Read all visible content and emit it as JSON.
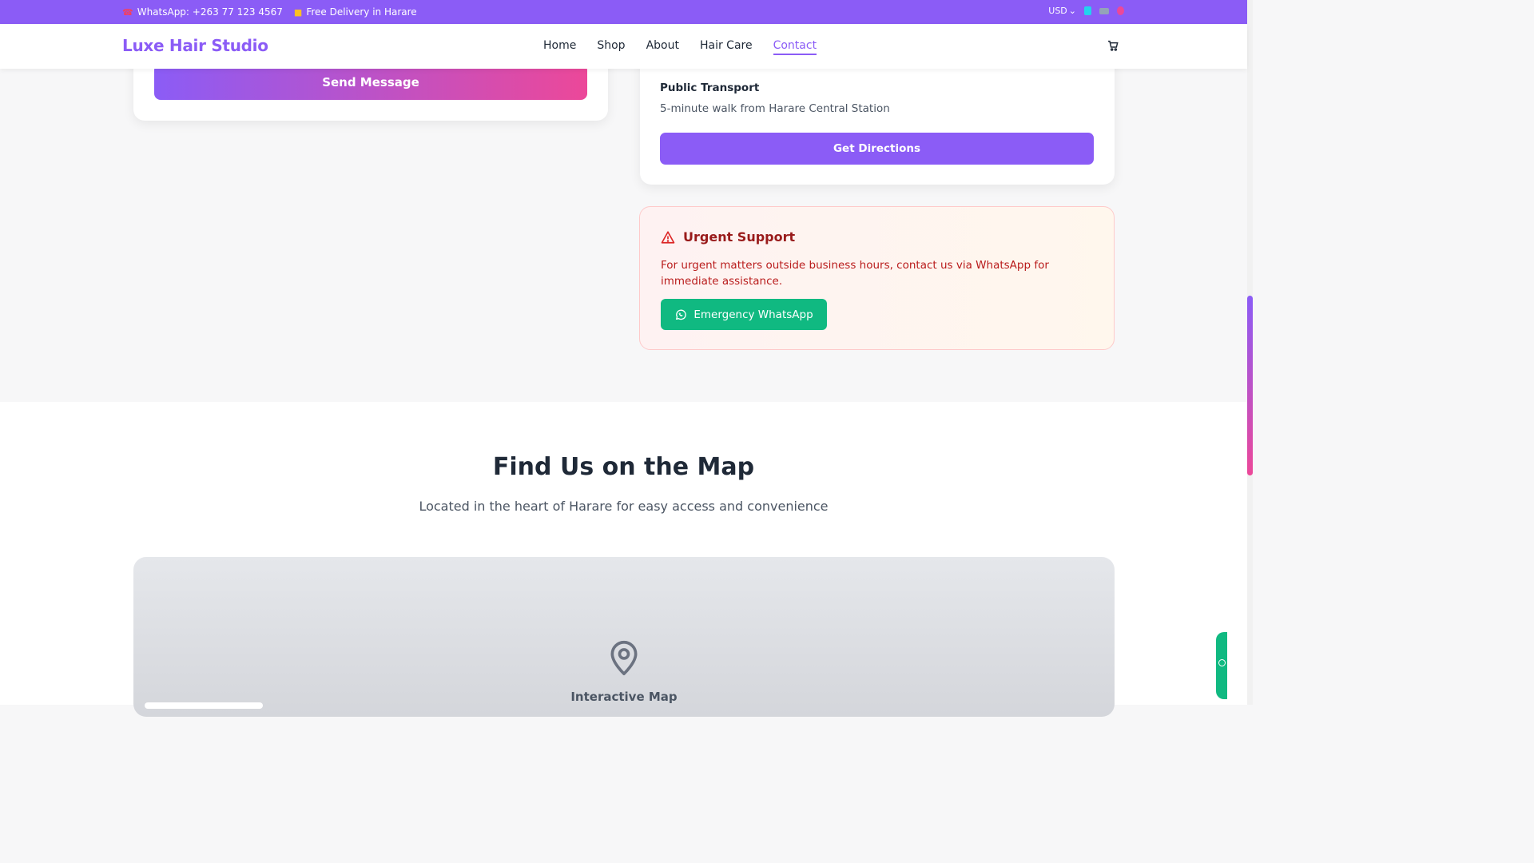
{
  "topbar": {
    "whatsapp": "WhatsApp: +263 77 123 4567",
    "delivery": "Free Delivery in Harare",
    "currency": "USD"
  },
  "header": {
    "logo": "Luxe Hair Studio",
    "nav": [
      "Home",
      "Shop",
      "About",
      "Hair Care",
      "Contact"
    ],
    "active_nav": "Contact"
  },
  "form": {
    "send_label": "Send Message"
  },
  "location": {
    "transport_title": "Public Transport",
    "transport_text": "5-minute walk from Harare Central Station",
    "directions_label": "Get Directions"
  },
  "urgent": {
    "title": "Urgent Support",
    "text": "For urgent matters outside business hours, contact us via WhatsApp for immediate assistance.",
    "button_label": "Emergency WhatsApp"
  },
  "map": {
    "title": "Find Us on the Map",
    "subtitle": "Located in the heart of Harare for easy access and convenience",
    "placeholder_label": "Interactive Map"
  },
  "colors": {
    "brand": "#8b5cf6",
    "accent": "#ec4899",
    "whatsapp": "#10b981",
    "urgent": "#991b1b"
  }
}
